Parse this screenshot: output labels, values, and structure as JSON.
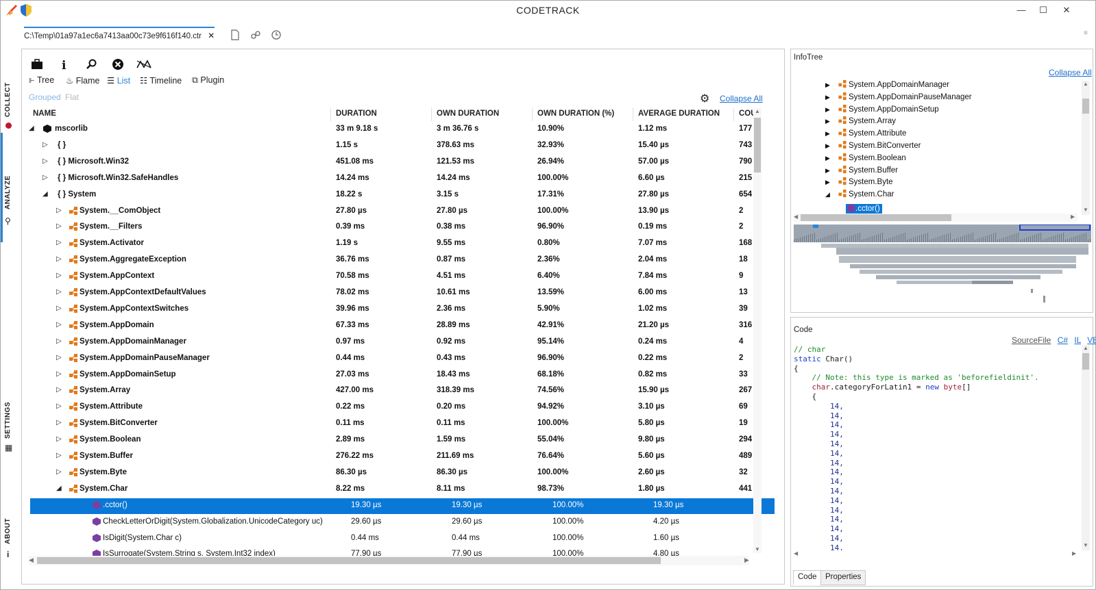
{
  "window": {
    "title": "CODETRACK",
    "minimize_icon": "minimize-icon",
    "maximize_icon": "maximize-icon",
    "close_icon": "close-icon"
  },
  "sidebar": {
    "tabs": [
      "COLLECT",
      "ANALYZE",
      "SETTINGS",
      "ABOUT"
    ],
    "active": "ANALYZE"
  },
  "file_tab": {
    "label": "C:\\Temp\\01a97a1ec6a7413aa00c73e9f616f140.ctr",
    "close": "✕"
  },
  "toolbar": {
    "views": [
      {
        "label": "Tree",
        "icon": "tree-icon"
      },
      {
        "label": "Flame",
        "icon": "flame-icon"
      },
      {
        "label": "List",
        "icon": "list-icon",
        "active": true
      },
      {
        "label": "Timeline",
        "icon": "timeline-icon"
      },
      {
        "label": "Plugin",
        "icon": "plugin-icon"
      }
    ],
    "grouped_label": "Grouped",
    "flat_label": "Flat",
    "collapse_all": "Collapse All"
  },
  "table": {
    "columns": [
      "NAME",
      "DURATION",
      "OWN DURATION",
      "OWN DURATION (%)",
      "AVERAGE DURATION",
      "COU"
    ],
    "rows": [
      {
        "name": "mscorlib",
        "duration": "33 m 9.18 s",
        "own": "3 m 36.76 s",
        "pct": "10.90%",
        "avg": "1.12 ms",
        "count": "177"
      },
      {
        "name": "{ }",
        "duration": "1.15 s",
        "own": "378.63 ms",
        "pct": "32.93%",
        "avg": "15.40 µs",
        "count": "743"
      },
      {
        "name": "{ } Microsoft.Win32",
        "duration": "451.08 ms",
        "own": "121.53 ms",
        "pct": "26.94%",
        "avg": "57.00 µs",
        "count": "790"
      },
      {
        "name": "{ } Microsoft.Win32.SafeHandles",
        "duration": "14.24 ms",
        "own": "14.24 ms",
        "pct": "100.00%",
        "avg": "6.60 µs",
        "count": "215"
      },
      {
        "name": "{ } System",
        "duration": "18.22 s",
        "own": "3.15 s",
        "pct": "17.31%",
        "avg": "27.80 µs",
        "count": "654"
      },
      {
        "name": "System.__ComObject",
        "duration": "27.80 µs",
        "own": "27.80 µs",
        "pct": "100.00%",
        "avg": "13.90 µs",
        "count": "2"
      },
      {
        "name": "System.__Filters",
        "duration": "0.39 ms",
        "own": "0.38 ms",
        "pct": "96.90%",
        "avg": "0.19 ms",
        "count": "2"
      },
      {
        "name": "System.Activator",
        "duration": "1.19 s",
        "own": "9.55 ms",
        "pct": "0.80%",
        "avg": "7.07 ms",
        "count": "168"
      },
      {
        "name": "System.AggregateException",
        "duration": "36.76 ms",
        "own": "0.87 ms",
        "pct": "2.36%",
        "avg": "2.04 ms",
        "count": "18"
      },
      {
        "name": "System.AppContext",
        "duration": "70.58 ms",
        "own": "4.51 ms",
        "pct": "6.40%",
        "avg": "7.84 ms",
        "count": "9"
      },
      {
        "name": "System.AppContextDefaultValues",
        "duration": "78.02 ms",
        "own": "10.61 ms",
        "pct": "13.59%",
        "avg": "6.00 ms",
        "count": "13"
      },
      {
        "name": "System.AppContextSwitches",
        "duration": "39.96 ms",
        "own": "2.36 ms",
        "pct": "5.90%",
        "avg": "1.02 ms",
        "count": "39"
      },
      {
        "name": "System.AppDomain",
        "duration": "67.33 ms",
        "own": "28.89 ms",
        "pct": "42.91%",
        "avg": "21.20 µs",
        "count": "316"
      },
      {
        "name": "System.AppDomainManager",
        "duration": "0.97 ms",
        "own": "0.92 ms",
        "pct": "95.14%",
        "avg": "0.24 ms",
        "count": "4"
      },
      {
        "name": "System.AppDomainPauseManager",
        "duration": "0.44 ms",
        "own": "0.43 ms",
        "pct": "96.90%",
        "avg": "0.22 ms",
        "count": "2"
      },
      {
        "name": "System.AppDomainSetup",
        "duration": "27.03 ms",
        "own": "18.43 ms",
        "pct": "68.18%",
        "avg": "0.82 ms",
        "count": "33"
      },
      {
        "name": "System.Array",
        "duration": "427.00 ms",
        "own": "318.39 ms",
        "pct": "74.56%",
        "avg": "15.90 µs",
        "count": "267"
      },
      {
        "name": "System.Attribute",
        "duration": "0.22 ms",
        "own": "0.20 ms",
        "pct": "94.92%",
        "avg": "3.10 µs",
        "count": "69"
      },
      {
        "name": "System.BitConverter",
        "duration": "0.11 ms",
        "own": "0.11 ms",
        "pct": "100.00%",
        "avg": "5.80 µs",
        "count": "19"
      },
      {
        "name": "System.Boolean",
        "duration": "2.89 ms",
        "own": "1.59 ms",
        "pct": "55.04%",
        "avg": "9.80 µs",
        "count": "294"
      },
      {
        "name": "System.Buffer",
        "duration": "276.22 ms",
        "own": "211.69 ms",
        "pct": "76.64%",
        "avg": "5.60 µs",
        "count": "489"
      },
      {
        "name": "System.Byte",
        "duration": "86.30 µs",
        "own": "86.30 µs",
        "pct": "100.00%",
        "avg": "2.60 µs",
        "count": "32"
      },
      {
        "name": "System.Char",
        "duration": "8.22 ms",
        "own": "8.11 ms",
        "pct": "98.73%",
        "avg": "1.80 µs",
        "count": "441"
      },
      {
        "name": ".cctor()",
        "duration": "19.30 µs",
        "own": "19.30 µs",
        "pct": "100.00%",
        "avg": "19.30 µs",
        "count": ""
      },
      {
        "name": "CheckLetterOrDigit(System.Globalization.UnicodeCategory uc)",
        "duration": "29.60 µs",
        "own": "29.60 µs",
        "pct": "100.00%",
        "avg": "4.20 µs",
        "count": ""
      },
      {
        "name": "IsDigit(System.Char c)",
        "duration": "0.44 ms",
        "own": "0.44 ms",
        "pct": "100.00%",
        "avg": "1.60 µs",
        "count": ""
      },
      {
        "name": "IsSurrogate(System.String s, System.Int32 index)",
        "duration": "77.90 µs",
        "own": "77.90 µs",
        "pct": "100.00%",
        "avg": "4.80 µs",
        "count": ""
      }
    ]
  },
  "infotree": {
    "title": "InfoTree",
    "collapse_all": "Collapse All",
    "items": [
      "System.AppDomainManager",
      "System.AppDomainPauseManager",
      "System.AppDomainSetup",
      "System.Array",
      "System.Attribute",
      "System.BitConverter",
      "System.Boolean",
      "System.Buffer",
      "System.Byte",
      "System.Char"
    ],
    "selected": ".cctor()"
  },
  "code": {
    "title": "Code",
    "links": [
      "SourceFile",
      "C#",
      "IL",
      "VB"
    ],
    "tabs": [
      "Code",
      "Properties"
    ],
    "line_comment": "// char",
    "line_sig_kw": "static",
    "line_sig_rest": " Char()",
    "line_open": "{",
    "line_note": "    // Note: this type is marked as 'beforefieldinit'.",
    "line_assign_ty": "char",
    "line_assign_mid": ".categoryForLatin1 = ",
    "line_assign_kw": "new",
    "line_assign_ty2": "byte",
    "line_assign_end": "[]",
    "line_brace": "    {",
    "value_line": "        14,"
  },
  "colors": {
    "accent": "#2b84d6",
    "selection": "#0a78d7",
    "class_icon": "#e07b1b",
    "method_icon": "#7b3fa0"
  }
}
